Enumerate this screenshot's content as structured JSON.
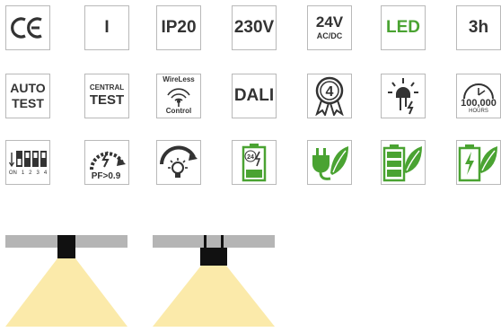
{
  "icons": {
    "ce": "CE",
    "class_one": "I",
    "ip": "IP20",
    "voltage": "230V",
    "dc_voltage": "24V",
    "dc_sub": "AC/DC",
    "led": "LED",
    "duration": "3h",
    "auto_top": "AUTO",
    "auto_bottom": "TEST",
    "central_top": "CENTRAL",
    "central_bottom": "TEST",
    "wireless_top": "WireLess",
    "wireless_bottom": "Control",
    "dali": "DALI",
    "warranty": "4",
    "hours_value": "100,000",
    "hours_label": "HOURS",
    "dip_labels": [
      "ON",
      "1",
      "2",
      "3",
      "4"
    ],
    "pf": "PF>0.9",
    "battery_hours": "24"
  },
  "colors": {
    "border": "#b9b9b9",
    "text": "#333333",
    "green": "#4aa332",
    "ceiling": "#b5b5b5",
    "light": "#fbeaaa",
    "fixture": "#111111"
  }
}
